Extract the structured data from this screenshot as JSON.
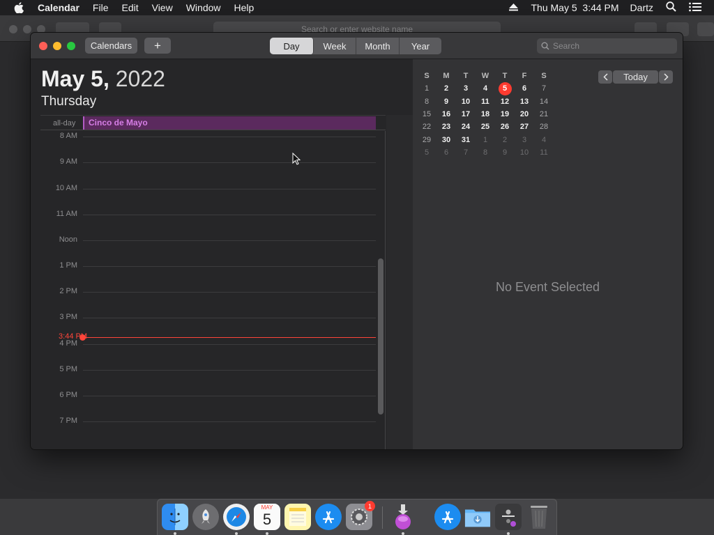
{
  "menubar": {
    "app_name": "Calendar",
    "items": [
      "File",
      "Edit",
      "View",
      "Window",
      "Help"
    ],
    "clock": "Thu May 5  3:44 PM",
    "user": "Dartz"
  },
  "background_browser": {
    "url_placeholder": "Search or enter website name"
  },
  "toolbar": {
    "calendars_label": "Calendars",
    "add_label": "+",
    "views": [
      "Day",
      "Week",
      "Month",
      "Year"
    ],
    "active_view": "Day",
    "search_placeholder": "Search"
  },
  "day_view": {
    "date_bold": "May 5,",
    "year": " 2022",
    "weekday": "Thursday",
    "allday_label": "all-day",
    "allday_event": "Cinco de Mayo",
    "allday_event_color": "#b35cc4",
    "hours": [
      "8 AM",
      "9 AM",
      "10 AM",
      "11 AM",
      "Noon",
      "1 PM",
      "2 PM",
      "3 PM",
      "4 PM",
      "5 PM",
      "6 PM",
      "7 PM"
    ],
    "current_time": "3:44 PM",
    "current_time_color": "#ff453a"
  },
  "mini_calendar": {
    "weekday_headers": [
      "S",
      "M",
      "T",
      "W",
      "T",
      "F",
      "S"
    ],
    "weeks": [
      [
        "1",
        "2",
        "3",
        "4",
        "5",
        "6",
        "7"
      ],
      [
        "8",
        "9",
        "10",
        "11",
        "12",
        "13",
        "14"
      ],
      [
        "15",
        "16",
        "17",
        "18",
        "19",
        "20",
        "21"
      ],
      [
        "22",
        "23",
        "24",
        "25",
        "26",
        "27",
        "28"
      ],
      [
        "29",
        "30",
        "31",
        "1",
        "2",
        "3",
        "4"
      ],
      [
        "5",
        "6",
        "7",
        "8",
        "9",
        "10",
        "11"
      ]
    ],
    "today": "5",
    "today_label": "Today",
    "prev_icon": "chevron-left-icon",
    "next_icon": "chevron-right-icon"
  },
  "detail": {
    "empty_text": "No Event Selected"
  },
  "dock": {
    "apps": [
      "Finder",
      "Launchpad",
      "Safari",
      "Calendar",
      "Notes",
      "App Store",
      "System Preferences",
      "Installer",
      "Applications",
      "Downloads",
      "Utilities",
      "Trash"
    ],
    "calendar_icon_month": "MAY",
    "calendar_icon_day": "5",
    "system_prefs_badge": "1"
  }
}
